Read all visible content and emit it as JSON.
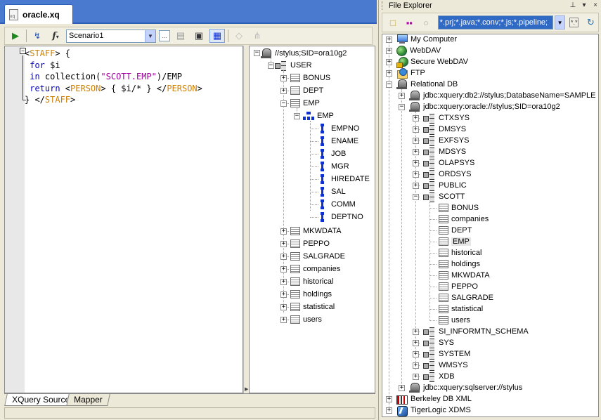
{
  "editor": {
    "doc_tab_label": "oracle.xq",
    "scenario": "Scenario1",
    "code_lines": [
      [
        {
          "t": "<",
          "c": ""
        },
        {
          "t": "STAFF",
          "c": "tag"
        },
        {
          "t": "> {",
          "c": ""
        }
      ],
      [
        {
          "t": " for ",
          "c": "kw"
        },
        {
          "t": "$i",
          "c": ""
        }
      ],
      [
        {
          "t": " in ",
          "c": "kw"
        },
        {
          "t": "collection(",
          "c": ""
        },
        {
          "t": "\"SCOTT.EMP\"",
          "c": "str"
        },
        {
          "t": ")/EMP",
          "c": ""
        }
      ],
      [
        {
          "t": " return ",
          "c": "kw"
        },
        {
          "t": "<",
          "c": ""
        },
        {
          "t": "PERSON",
          "c": "tag"
        },
        {
          "t": "> { $i/* } </",
          "c": ""
        },
        {
          "t": "PERSON",
          "c": "tag"
        },
        {
          "t": ">",
          "c": ""
        }
      ],
      [
        {
          "t": "} </",
          "c": ""
        },
        {
          "t": "STAFF",
          "c": "tag"
        },
        {
          "t": ">",
          "c": ""
        }
      ]
    ],
    "bottom_tabs": [
      "XQuery Source",
      "Mapper"
    ]
  },
  "schema_tree": {
    "root": "//stylus;SID=ora10g2",
    "user": "USER",
    "tables_before": [
      "BONUS",
      "DEPT"
    ],
    "emp_table": "EMP",
    "emp_element": "EMP",
    "columns": [
      "EMPNO",
      "ENAME",
      "JOB",
      "MGR",
      "HIREDATE",
      "SAL",
      "COMM",
      "DEPTNO"
    ],
    "tables_after": [
      "MKWDATA",
      "PEPPO",
      "SALGRADE",
      "companies",
      "historical",
      "holdings",
      "statistical",
      "users"
    ]
  },
  "file_explorer": {
    "title": "File Explorer",
    "filter": "*.prj;*.java;*.conv;*.js;*.pipeline;",
    "roots": [
      {
        "label": "My Computer",
        "icon": "computer-icon"
      },
      {
        "label": "WebDAV",
        "icon": "globe-icon"
      },
      {
        "label": "Secure WebDAV",
        "icon": "secure-globe-icon"
      },
      {
        "label": "FTP",
        "icon": "ftp-icon"
      }
    ],
    "relational_db": "Relational DB",
    "conn_db2": "jdbc:xquery:db2://stylus;DatabaseName=SAMPLE",
    "conn_oracle": "jdbc:xquery:oracle://stylus;SID=ora10g2",
    "schemas_before": [
      "CTXSYS",
      "DMSYS",
      "EXFSYS",
      "MDSYS",
      "OLAPSYS",
      "ORDSYS",
      "PUBLIC"
    ],
    "scott": "SCOTT",
    "scott_tables": [
      "BONUS",
      "companies",
      "DEPT",
      "EMP",
      "historical",
      "holdings",
      "MKWDATA",
      "PEPPO",
      "SALGRADE",
      "statistical",
      "users"
    ],
    "selected_table": "EMP",
    "schemas_after": [
      "SI_INFORMTN_SCHEMA",
      "SYS",
      "SYSTEM",
      "WMSYS",
      "XDB"
    ],
    "conn_sqlserver": "jdbc:xquery:sqlserver://stylus",
    "berkeley": "Berkeley DB XML",
    "tigerlogic": "TigerLogic XDMS"
  }
}
